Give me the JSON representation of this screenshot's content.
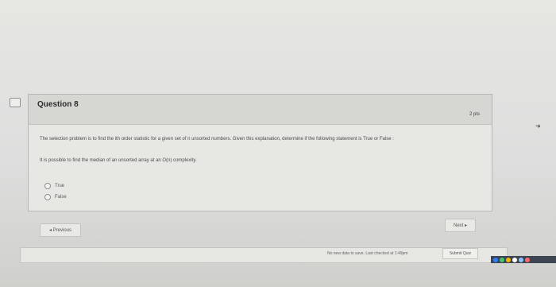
{
  "question": {
    "title": "Question 8",
    "points": "2 pts",
    "prompt": "The selection problem is to find the ith order statistic for a given set of n unsorted numbers. Given this explanation, determine if the following statement is True or False :",
    "statement": "It is possible to find the median of an unsorted array at an O(n) complexity.",
    "options": [
      {
        "label": "True",
        "selected": false
      },
      {
        "label": "False",
        "selected": false
      }
    ]
  },
  "navigation": {
    "previous_label": "◂ Previous",
    "next_label": "Next ▸"
  },
  "footer": {
    "status": "No new data to save. Last checked at 1:49pm",
    "submit_label": "Submit Quiz"
  },
  "icons": {
    "flag": "flag-icon",
    "cursor": "cursor-arrow-icon"
  },
  "colors": {
    "background": "#dcdcd9",
    "card": "#e7e7e4",
    "header": "#d6d6d3",
    "taskbar": "#3d4452"
  }
}
